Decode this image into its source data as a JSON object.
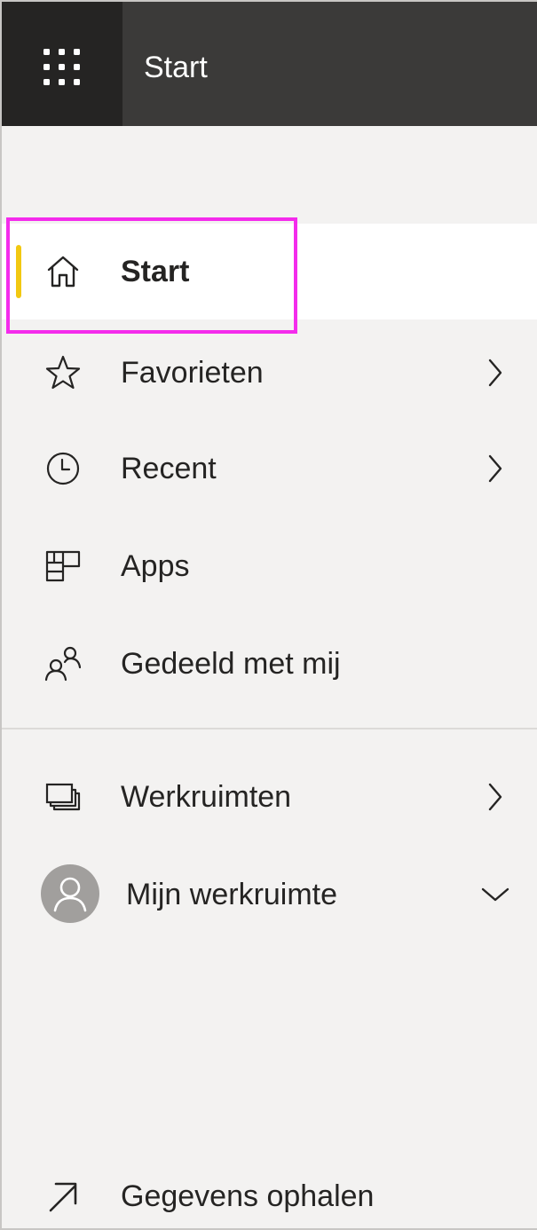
{
  "topbar": {
    "title": "Start",
    "app_launcher_icon": "waffle-grid-icon"
  },
  "nav": {
    "items": [
      {
        "label": "Start",
        "icon": "home-icon",
        "selected": true,
        "has_chevron": false
      },
      {
        "label": "Favorieten",
        "icon": "star-icon",
        "selected": false,
        "has_chevron": true
      },
      {
        "label": "Recent",
        "icon": "clock-icon",
        "selected": false,
        "has_chevron": true
      },
      {
        "label": "Apps",
        "icon": "apps-icon",
        "selected": false,
        "has_chevron": false
      },
      {
        "label": "Gedeeld met mij",
        "icon": "shared-people-icon",
        "selected": false,
        "has_chevron": false
      }
    ],
    "workspaces": [
      {
        "label": "Werkruimten",
        "icon": "workspaces-icon",
        "chevron": "chevron-right-icon"
      },
      {
        "label": "Mijn werkruimte",
        "icon": "avatar-icon",
        "chevron": "chevron-down-icon"
      }
    ],
    "footer": {
      "label": "Gegevens ophalen",
      "icon": "arrow-up-right-icon"
    }
  },
  "colors": {
    "topbar": "#3b3a39",
    "launcher": "#252423",
    "nav_background": "#f3f2f1",
    "selected_background": "#ffffff",
    "selected_indicator": "#f2c811",
    "highlight_outline": "#f42cec"
  }
}
